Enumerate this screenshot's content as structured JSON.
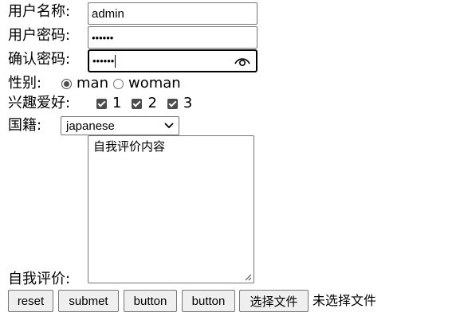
{
  "form": {
    "username": {
      "label": "用户名称:",
      "value": "admin"
    },
    "password": {
      "label": "用户密码:",
      "value": "••••••"
    },
    "confirm": {
      "label": "确认密码:",
      "value": "••••••"
    },
    "gender": {
      "label": "性别:",
      "options": [
        "man",
        "woman"
      ],
      "selected": "man"
    },
    "hobbies": {
      "label": "兴趣爱好:",
      "options": [
        "1",
        "2",
        "3"
      ],
      "checked": [
        "1",
        "2",
        "3"
      ]
    },
    "nationality": {
      "label": "国籍:",
      "selected": "japanese"
    },
    "self_eval": {
      "label": "自我评价:",
      "value": "自我评价内容"
    },
    "buttons": {
      "reset": "reset",
      "submit": "submet",
      "button1": "button",
      "button2": "button"
    },
    "file": {
      "button": "选择文件",
      "status": "未选择文件"
    }
  },
  "icons": {
    "reveal_password": "eye-icon",
    "dropdown": "chevron-down-icon",
    "resize": "resize-grip-icon"
  }
}
